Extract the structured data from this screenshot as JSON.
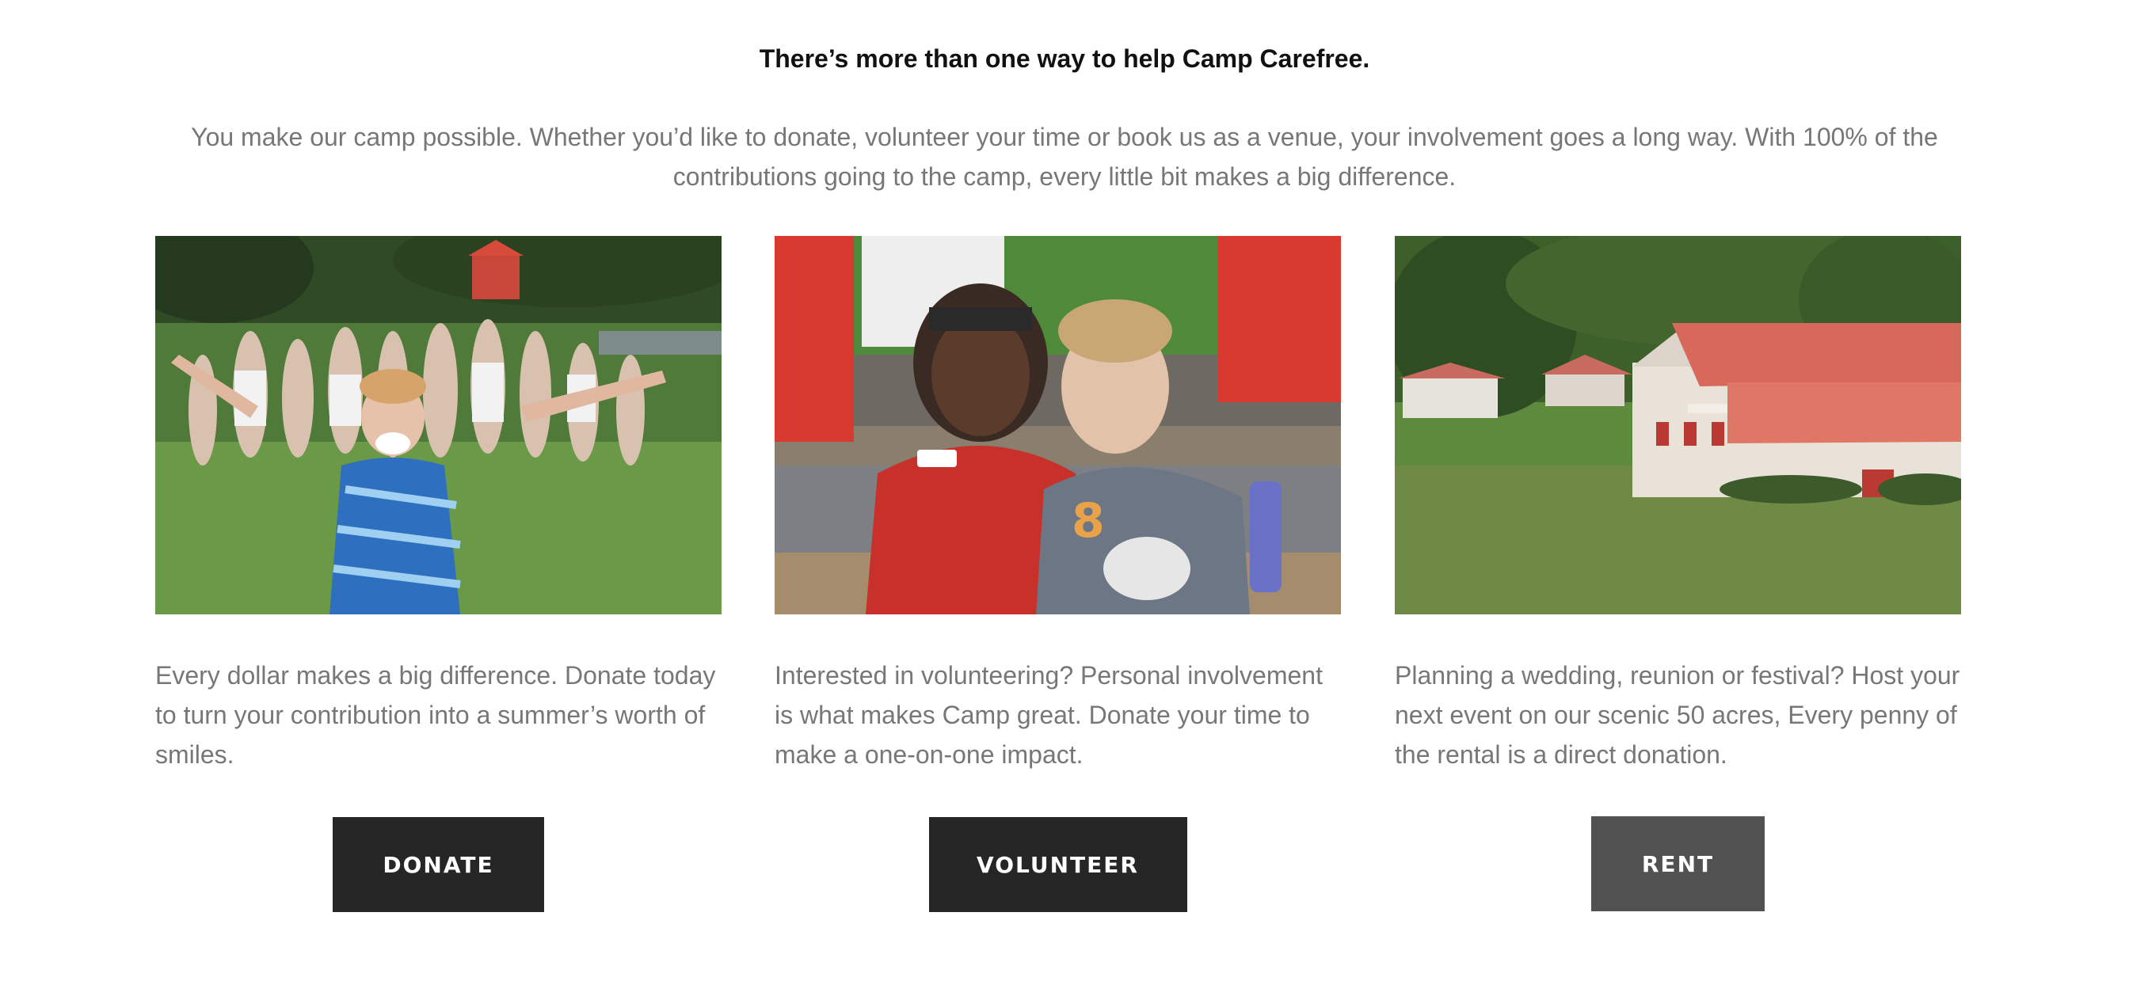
{
  "section": {
    "heading": "There’s more than one way to help Camp Carefree.",
    "intro": "You make our camp possible. Whether you’d like to donate, volunteer your time or book us as a venue, your involvement goes a long way. With 100% of the contributions going to the camp, every little bit makes a big difference."
  },
  "cards": [
    {
      "text": "Every dollar makes a big difference. Donate today to turn your contribution into a summer’s worth of smiles.",
      "button": "DONATE"
    },
    {
      "text": "Interested in volunteering? Personal involvement is what makes Camp great. Donate your time to make a one-on-one impact.",
      "button": "VOLUNTEER"
    },
    {
      "text": "Planning a wedding, reunion or festival? Host your next event on our scenic 50 acres, Every penny of the rental is a direct donation.",
      "button": "RENT"
    }
  ]
}
